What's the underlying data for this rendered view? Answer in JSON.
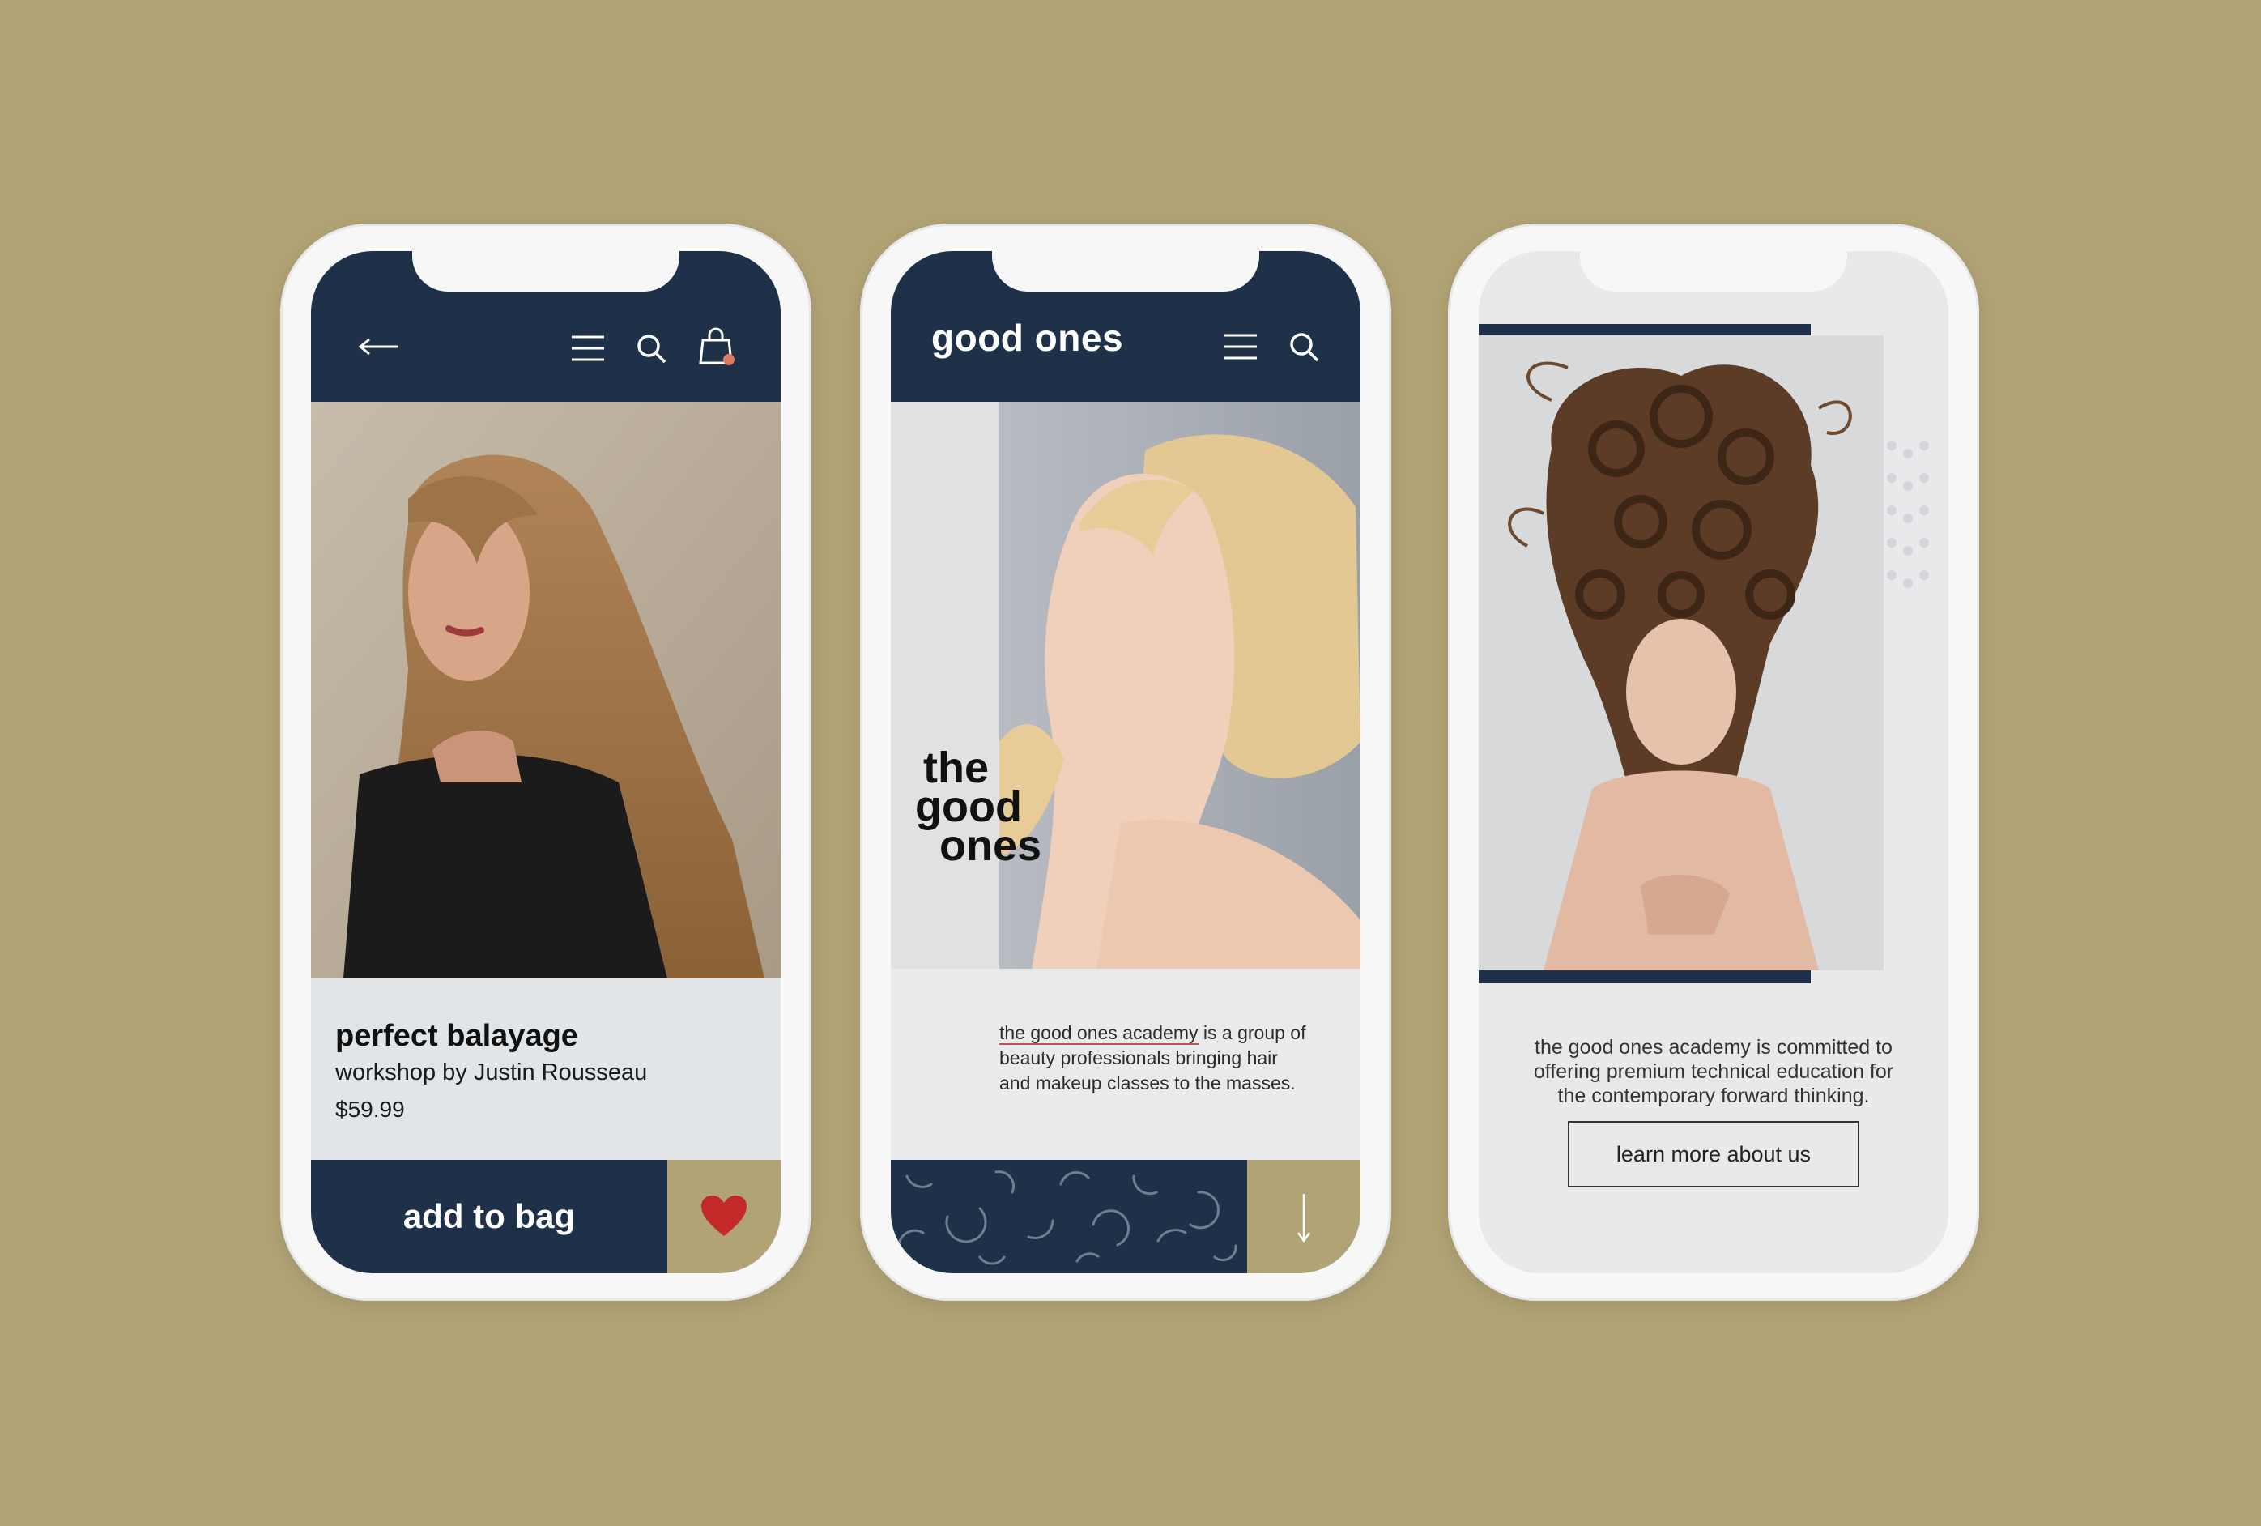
{
  "colors": {
    "background": "#b1a375",
    "navy": "#1e3148",
    "gold": "#b1a375",
    "heart": "#c22a2a",
    "underline": "#c84f4f"
  },
  "phone1": {
    "nav": {
      "back_icon": "arrow-left-icon",
      "menu_icon": "hamburger-icon",
      "search_icon": "search-icon",
      "bag_icon": "shopping-bag-icon"
    },
    "product": {
      "title": "perfect balayage",
      "subtitle": "workshop by Justin Rousseau",
      "price": "$59.99"
    },
    "cta": {
      "label": "add to bag"
    },
    "favorite_icon": "heart-icon"
  },
  "phone2": {
    "brand": "good ones",
    "nav": {
      "menu_icon": "hamburger-icon",
      "search_icon": "search-icon"
    },
    "wordmark": {
      "line1": "the",
      "line2": "good",
      "line3": "ones"
    },
    "description": {
      "link": "the good ones academy",
      "text1": " is a group of",
      "text2": "beauty professionals bringing hair",
      "text3": "and makeup classes to the masses."
    },
    "scroll_icon": "arrow-down-icon"
  },
  "phone3": {
    "description": {
      "line1": "the good ones academy is committed to",
      "line2": "offering premium technical education for",
      "line3": "the contemporary forward thinking."
    },
    "button": {
      "label": "learn more about us"
    }
  }
}
